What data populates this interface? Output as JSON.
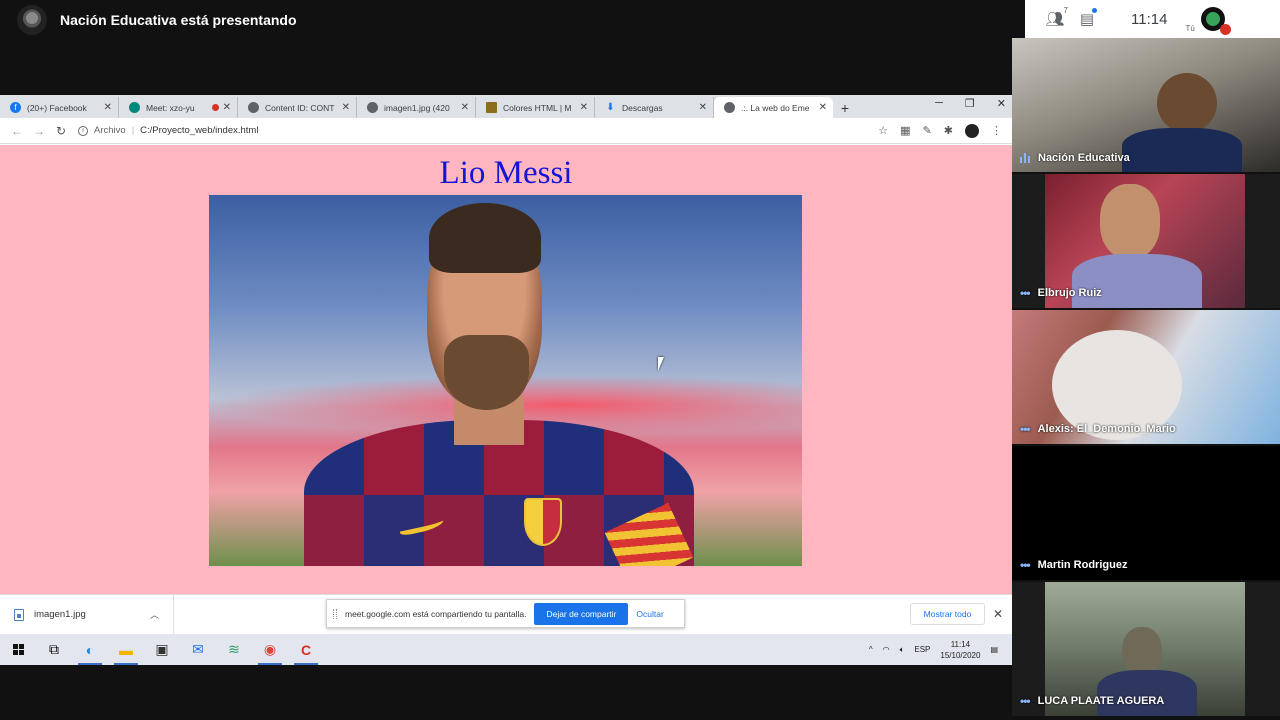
{
  "meet": {
    "presenter_banner": "Nación Educativa está presentando",
    "time": "11:14",
    "participants_count": "7",
    "self_label": "Tú",
    "participants": [
      {
        "name": "Nación Educativa"
      },
      {
        "name": "Elbrujo Ruiz"
      },
      {
        "name": "Alexis: El_Demonio_Mario"
      },
      {
        "name": "Martin Rodriguez"
      },
      {
        "name": "LUCA PLAATE AGUERA"
      }
    ]
  },
  "browser": {
    "tabs": [
      {
        "label": "(20+) Facebook",
        "icon": "facebook-icon",
        "color": "#1877f2"
      },
      {
        "label": "Meet: xzo-yu",
        "icon": "meet-icon",
        "color": "#00897b",
        "recording": true
      },
      {
        "label": "Content ID: CONT",
        "icon": "globe-icon",
        "color": "#5f6368"
      },
      {
        "label": "imagen1.jpg (420",
        "icon": "globe-icon",
        "color": "#5f6368"
      },
      {
        "label": "Colores HTML | M",
        "icon": "colors-icon",
        "color": "#8a6d1e"
      },
      {
        "label": "Descargas",
        "icon": "download-icon",
        "color": "#1a73e8"
      },
      {
        "label": ".:. La web do Eme",
        "icon": "globe-icon",
        "color": "#5f6368",
        "active": true
      }
    ],
    "address": {
      "protocol": "Archivo",
      "url": "C:/Proyecto_web/index.html"
    },
    "page": {
      "heading": "Lio Messi",
      "background": "#ffb6c1",
      "heading_color": "#1414d6"
    },
    "download_shelf": {
      "file": "imagen1.jpg",
      "share_notice": "meet.google.com está compartiendo tu pantalla.",
      "stop_sharing": "Dejar de compartir",
      "hide": "Ocultar",
      "show_all": "Mostrar todo"
    }
  },
  "taskbar": {
    "language": "ESP",
    "time": "11:14",
    "date": "15/10/2020"
  }
}
